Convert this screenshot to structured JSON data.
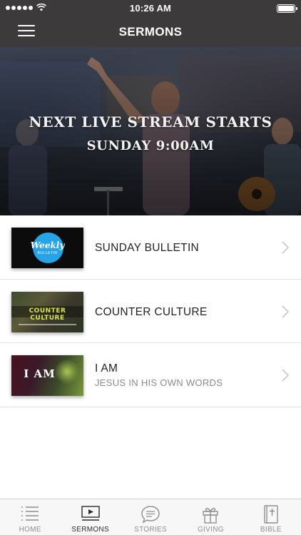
{
  "status_bar": {
    "time": "10:26 AM"
  },
  "nav": {
    "title": "SERMONS"
  },
  "hero": {
    "line1": "NEXT LIVE STREAM STARTS",
    "line2": "SUNDAY 9:00AM"
  },
  "sermons": [
    {
      "title": "SUNDAY BULLETIN",
      "subtitle": "",
      "thumb_text": "Weekly",
      "thumb_subtext": "BULLETIN"
    },
    {
      "title": "COUNTER CULTURE",
      "subtitle": "",
      "thumb_text": "COUNTER CULTURE"
    },
    {
      "title": "I AM",
      "subtitle": "JESUS IN HIS OWN WORDS",
      "thumb_text": "I AM"
    }
  ],
  "tabs": [
    {
      "label": "HOME",
      "icon": "list-icon",
      "active": false
    },
    {
      "label": "SERMONS",
      "icon": "play-icon",
      "active": true
    },
    {
      "label": "STORIES",
      "icon": "chat-bubble-icon",
      "active": false
    },
    {
      "label": "GIVING",
      "icon": "gift-icon",
      "active": false
    },
    {
      "label": "BIBLE",
      "icon": "bible-icon",
      "active": false
    }
  ],
  "colors": {
    "nav_background": "#3d3a3b",
    "weekly_accent": "#27a4e8",
    "counter_accent": "#d8e34a"
  }
}
